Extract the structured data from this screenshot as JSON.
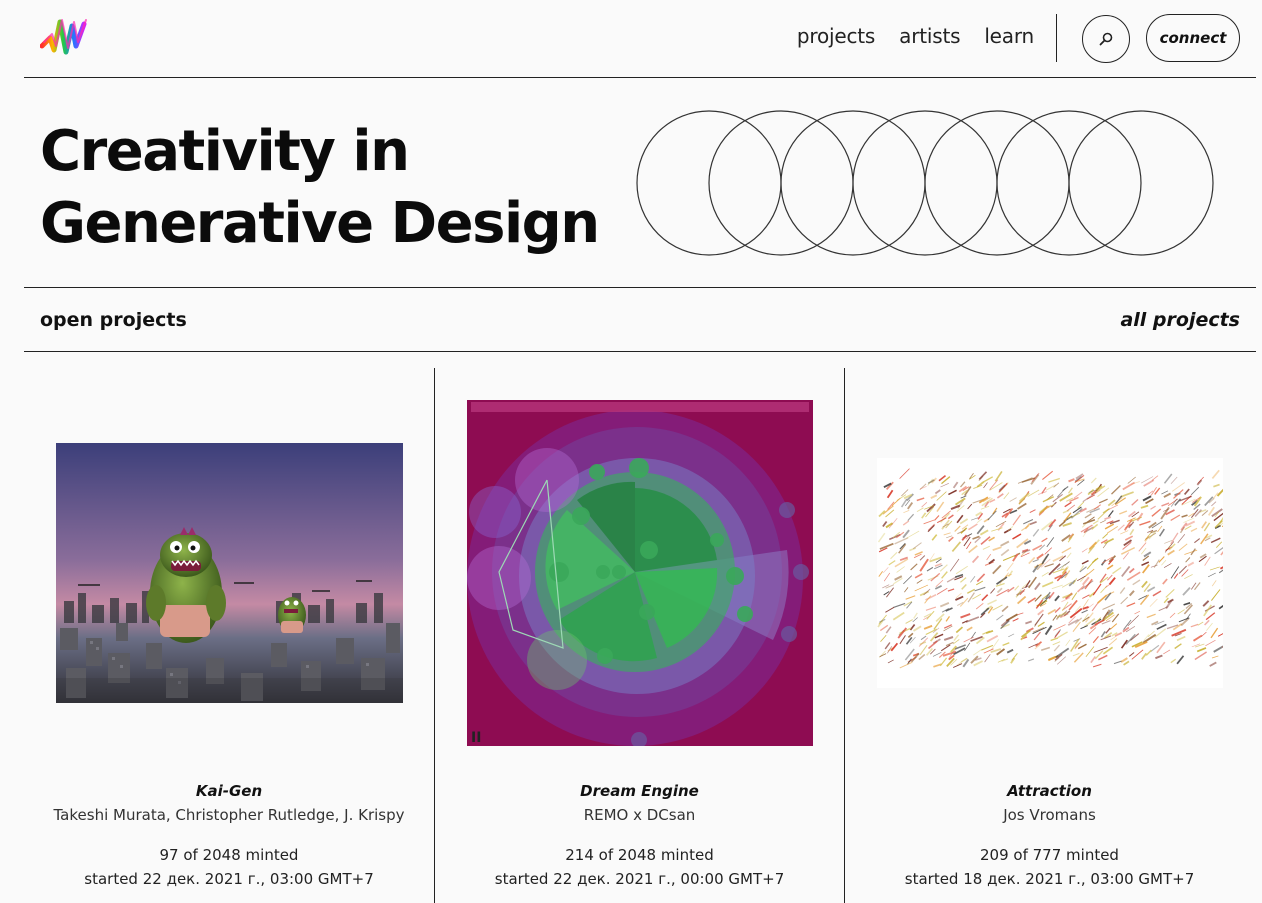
{
  "header": {
    "nav": [
      {
        "label": "projects"
      },
      {
        "label": "artists"
      },
      {
        "label": "learn"
      }
    ],
    "search_icon": "search-icon",
    "connect_label": "connect"
  },
  "hero": {
    "title_line1": "Creativity in",
    "title_line2": "Generative Design"
  },
  "section": {
    "open_label": "open projects",
    "all_label": "all projects"
  },
  "projects": [
    {
      "title": "Kai-Gen",
      "artist": "Takeshi Murata, Christopher Rutledge, J. Krispy",
      "minted": "97 of 2048 minted",
      "started": "started 22 дек. 2021 г., 03:00 GMT+7"
    },
    {
      "title": "Dream Engine",
      "artist": "REMO x DCsan",
      "minted": "214 of 2048 minted",
      "started": "started 22 дек. 2021 г., 00:00 GMT+7",
      "pause_glyph": "II"
    },
    {
      "title": "Attraction",
      "artist": "Jos Vromans",
      "minted": "209 of 777 minted",
      "started": "started 18 дек. 2021 г., 03:00 GMT+7"
    }
  ],
  "colors": {
    "background": "#fafafa",
    "text": "#111111",
    "dream_bg": "#8e0c52",
    "dream_green": "#2ecc40"
  }
}
